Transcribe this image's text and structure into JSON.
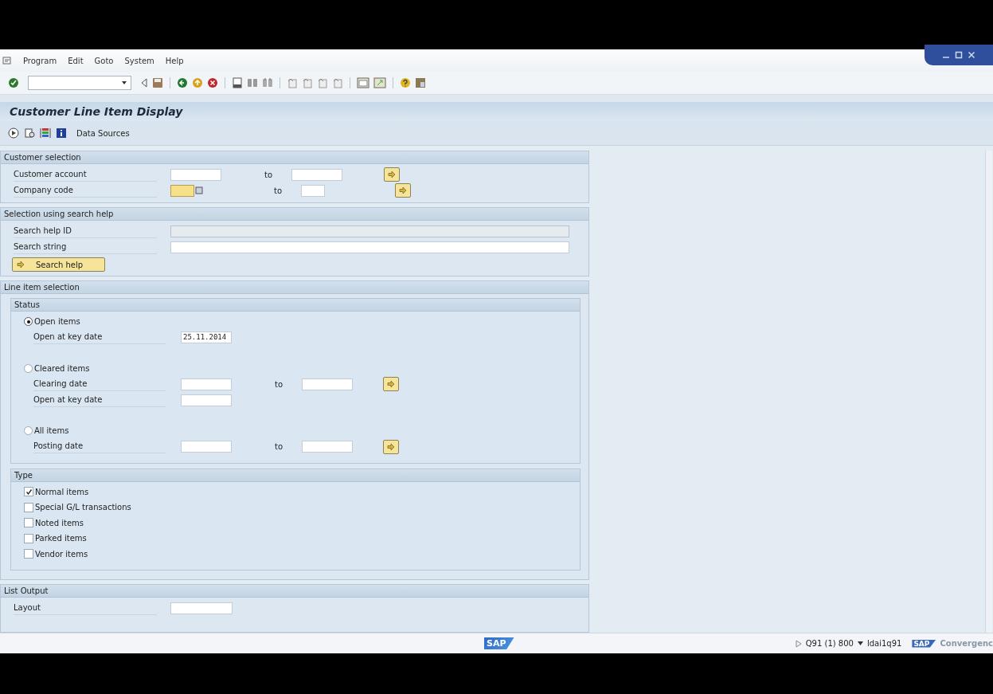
{
  "menu": [
    "Program",
    "Edit",
    "Goto",
    "System",
    "Help"
  ],
  "title": "Customer Line Item Display",
  "app_toolbar": {
    "label": "Data Sources"
  },
  "customer_selection": {
    "title": "Customer selection",
    "rows": [
      {
        "kind": "range",
        "label": "Customer account",
        "to": "to",
        "highlighted": false
      },
      {
        "kind": "code_range",
        "label": "Company code",
        "to": "to",
        "highlighted": true
      }
    ]
  },
  "search_help": {
    "title": "Selection using search help",
    "fields": [
      {
        "label": "Search help ID",
        "disabled": true
      },
      {
        "label": "Search string",
        "disabled": false
      }
    ],
    "button": "Search help"
  },
  "line_item_selection": {
    "title": "Line item selection",
    "status": {
      "title": "Status",
      "options": [
        {
          "label": "Open items",
          "selected": true,
          "fields": [
            {
              "label": "Open at key date",
              "value": "25.11.2014"
            }
          ]
        },
        {
          "label": "Cleared items",
          "selected": false,
          "fields": [
            {
              "label": "Clearing date",
              "to": "to"
            },
            {
              "label": "Open at key date"
            }
          ]
        },
        {
          "label": "All items",
          "selected": false,
          "fields": [
            {
              "label": "Posting date",
              "to": "to"
            }
          ]
        }
      ]
    },
    "type": {
      "title": "Type",
      "items": [
        {
          "label": "Normal items",
          "checked": true
        },
        {
          "label": "Special G/L transactions",
          "checked": false
        },
        {
          "label": "Noted items",
          "checked": false
        },
        {
          "label": "Parked items",
          "checked": false
        },
        {
          "label": "Vendor items",
          "checked": false
        }
      ]
    }
  },
  "list_output": {
    "title": "List Output",
    "fields": [
      {
        "label": "Layout"
      }
    ]
  },
  "status_bar": {
    "logo": "SAP",
    "product_logo": "SAP",
    "system": "Q91 (1) 800",
    "server": "ldai1q91",
    "product": "Convergenc"
  }
}
